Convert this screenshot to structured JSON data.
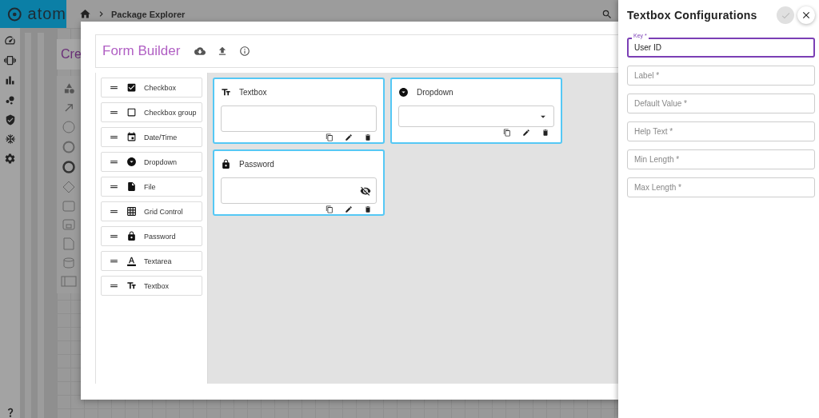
{
  "app": {
    "logo_text": "atom",
    "breadcrumb": "Package Explorer",
    "canvas_title": "Cre"
  },
  "form_builder": {
    "title": "Form Builder",
    "palette": [
      {
        "label": "Checkbox",
        "kind": "checkbox"
      },
      {
        "label": "Checkbox group",
        "kind": "checkbox_group"
      },
      {
        "label": "Date/Time",
        "kind": "datetime"
      },
      {
        "label": "Dropdown",
        "kind": "dropdown"
      },
      {
        "label": "File",
        "kind": "file"
      },
      {
        "label": "Grid Control",
        "kind": "grid"
      },
      {
        "label": "Password",
        "kind": "password"
      },
      {
        "label": "Textarea",
        "kind": "textarea"
      },
      {
        "label": "Textbox",
        "kind": "textbox"
      }
    ],
    "fields": [
      {
        "label": "Textbox",
        "kind": "textbox"
      },
      {
        "label": "Dropdown",
        "kind": "dropdown"
      },
      {
        "label": "Password",
        "kind": "password"
      }
    ]
  },
  "config": {
    "title": "Textbox Configurations",
    "confirm_disabled": true,
    "fields": [
      {
        "label": "Key *",
        "value": "User ID",
        "focused": true
      },
      {
        "placeholder": "Label *",
        "focused": false
      },
      {
        "placeholder": "Default Value *",
        "focused": false
      },
      {
        "placeholder": "Help Text *",
        "focused": false
      },
      {
        "placeholder": "Min Length *",
        "focused": false
      },
      {
        "placeholder": "Max Length *",
        "focused": false
      }
    ]
  }
}
